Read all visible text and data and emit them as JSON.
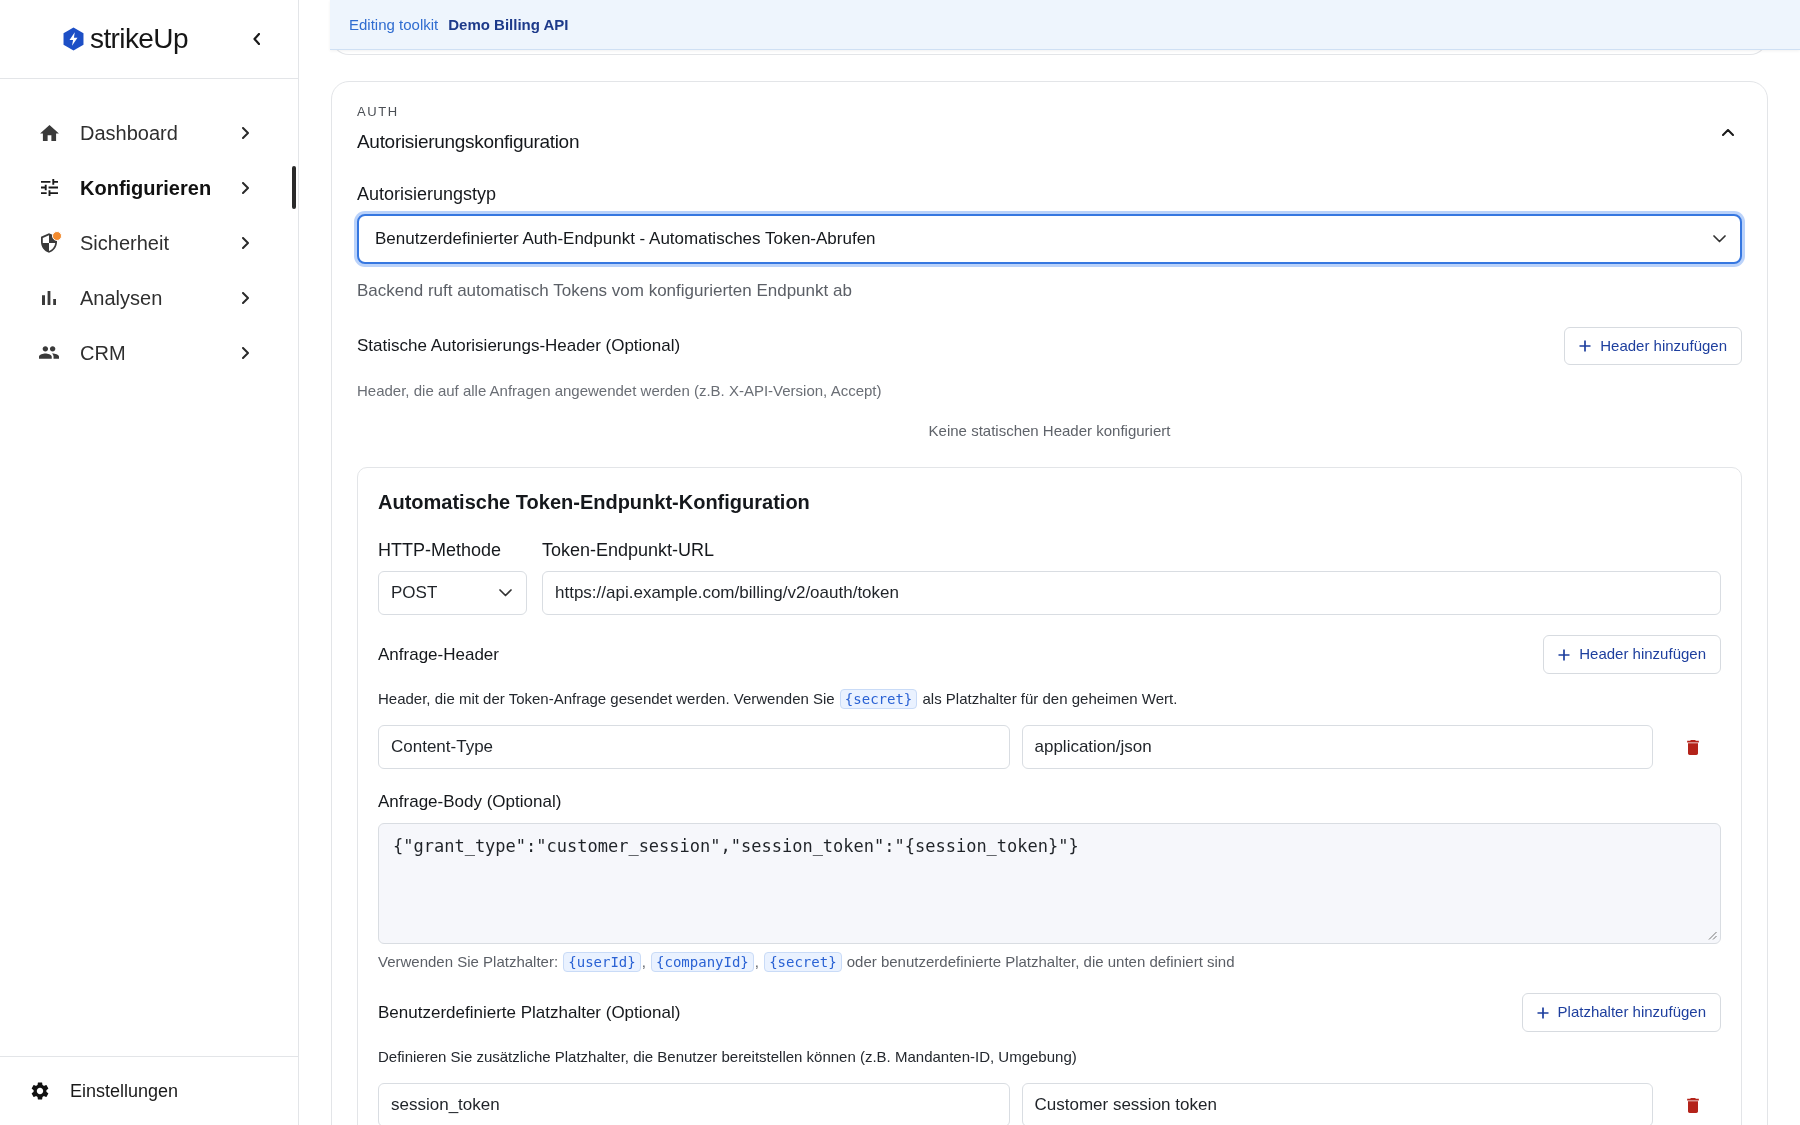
{
  "sidebar": {
    "brand": "strikeUp",
    "items": [
      {
        "label": "Dashboard",
        "selected": false,
        "alert": false
      },
      {
        "label": "Konfigurieren",
        "selected": true,
        "alert": false
      },
      {
        "label": "Sicherheit",
        "selected": false,
        "alert": true
      },
      {
        "label": "Analysen",
        "selected": false,
        "alert": false
      },
      {
        "label": "CRM",
        "selected": false,
        "alert": false
      }
    ],
    "footer_item": {
      "label": "Einstellungen"
    }
  },
  "banner": {
    "label": "Editing toolkit",
    "toolkit_name": "Demo Billing API"
  },
  "auth_section": {
    "eyebrow": "AUTH",
    "title": "Autorisierungskonfiguration",
    "expanded": true,
    "auth_type": {
      "label": "Autorisierungstyp",
      "value": "Benutzerdefinierter Auth-Endpunkt - Automatisches Token-Abrufen",
      "focused": true,
      "help": "Backend ruft automatisch Tokens vom konfigurierten Endpunkt ab"
    },
    "static_headers": {
      "title": "Statische Autorisierungs-Header (Optional)",
      "add_button": "Header hinzufügen",
      "help": "Header, die auf alle Anfragen angewendet werden (z.B. X-API-Version, Accept)",
      "empty_text": "Keine statischen Header konfiguriert"
    },
    "token_endpoint": {
      "title": "Automatische Token-Endpunkt-Konfiguration",
      "method": {
        "label": "HTTP-Methode",
        "value": "POST"
      },
      "url": {
        "label": "Token-Endpunkt-URL",
        "value": "https://api.example.com/billing/v2/oauth/token"
      },
      "request_headers": {
        "title": "Anfrage-Header",
        "add_button": "Header hinzufügen",
        "help": [
          {
            "kind": "text",
            "text": "Header, die mit der Token-Anfrage gesendet werden. Verwenden Sie "
          },
          {
            "kind": "code",
            "text": "{secret}"
          },
          {
            "kind": "text",
            "text": " als Platzhalter für den geheimen Wert."
          }
        ],
        "rows": [
          {
            "name": "Content-Type",
            "value": "application/json"
          }
        ]
      },
      "request_body": {
        "label": "Anfrage-Body (Optional)",
        "value": "{\"grant_type\":\"customer_session\",\"session_token\":\"{session_token}\"}",
        "help": [
          {
            "kind": "text",
            "text": "Verwenden Sie Platzhalter: "
          },
          {
            "kind": "code",
            "text": "{userId}"
          },
          {
            "kind": "text",
            "text": ", "
          },
          {
            "kind": "code",
            "text": "{companyId}"
          },
          {
            "kind": "text",
            "text": ", "
          },
          {
            "kind": "code",
            "text": "{secret}"
          },
          {
            "kind": "text",
            "text": " oder benutzerdefinierte Platzhalter, die unten definiert sind"
          }
        ]
      },
      "custom_placeholders": {
        "title": "Benutzerdefinierte Platzhalter (Optional)",
        "add_button": "Platzhalter hinzufügen",
        "help": "Definieren Sie zusätzliche Platzhalter, die Benutzer bereitstellen können (z.B. Mandanten-ID, Umgebung)",
        "rows": [
          {
            "name": "session_token",
            "label": "Customer session token"
          }
        ]
      }
    }
  }
}
